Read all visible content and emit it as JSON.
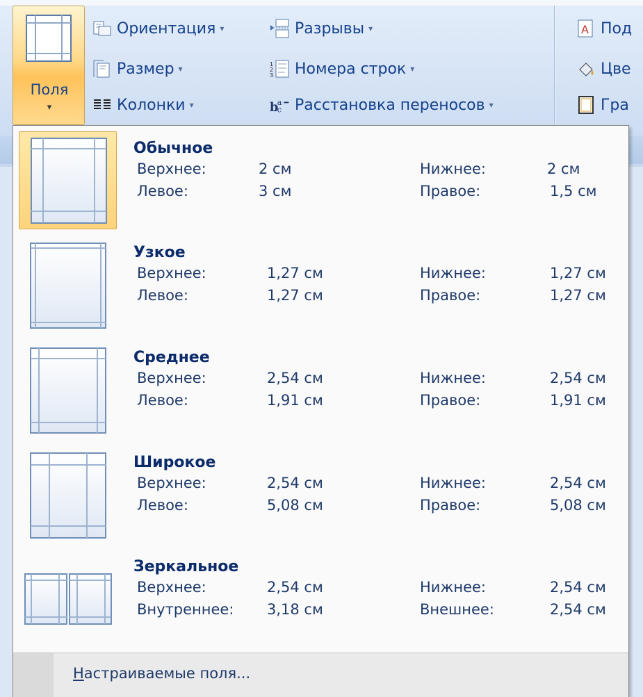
{
  "ribbon": {
    "fields_button": {
      "label": "Поля",
      "arrow": "▾"
    },
    "items": [
      {
        "label": "Ориентация",
        "arrow": "▾",
        "icon": "orientation-icon"
      },
      {
        "label": "Размер",
        "arrow": "▾",
        "icon": "size-icon"
      },
      {
        "label": "Колонки",
        "arrow": "▾",
        "icon": "columns-icon"
      },
      {
        "label": "Разрывы",
        "arrow": "▾",
        "icon": "breaks-icon"
      },
      {
        "label": "Номера строк",
        "arrow": "▾",
        "icon": "line-numbers-icon"
      },
      {
        "label": "Расстановка переносов",
        "arrow": "▾",
        "icon": "hyphenation-icon"
      },
      {
        "label": "Под",
        "icon": "watermark-icon"
      },
      {
        "label": "Цве",
        "icon": "page-color-icon"
      },
      {
        "label": "Гра",
        "icon": "page-borders-icon"
      }
    ]
  },
  "menu": {
    "options": [
      {
        "name": "Обычное",
        "selected": true,
        "l1": "Верхнее:",
        "v1": "2 см",
        "l2": "Нижнее:",
        "v2": "2 см",
        "l3": "Левое:",
        "v3": "3 см",
        "l4": "Правое:",
        "v4": "1,5 см"
      },
      {
        "name": "Узкое",
        "selected": false,
        "l1": "Верхнее:",
        "v1": "1,27 см",
        "l2": "Нижнее:",
        "v2": "1,27 см",
        "l3": "Левое:",
        "v3": "1,27 см",
        "l4": "Правое:",
        "v4": "1,27 см"
      },
      {
        "name": "Среднее",
        "selected": false,
        "l1": "Верхнее:",
        "v1": "2,54 см",
        "l2": "Нижнее:",
        "v2": "2,54 см",
        "l3": "Левое:",
        "v3": "1,91 см",
        "l4": "Правое:",
        "v4": "1,91 см"
      },
      {
        "name": "Широкое",
        "selected": false,
        "l1": "Верхнее:",
        "v1": "2,54 см",
        "l2": "Нижнее:",
        "v2": "2,54 см",
        "l3": "Левое:",
        "v3": "5,08 см",
        "l4": "Правое:",
        "v4": "5,08 см"
      },
      {
        "name": "Зеркальное",
        "selected": false,
        "l1": "Верхнее:",
        "v1": "2,54 см",
        "l2": "Нижнее:",
        "v2": "2,54 см",
        "l3": "Внутреннее:",
        "v3": "3,18 см",
        "l4": "Внешнее:",
        "v4": "2,54 см"
      }
    ],
    "custom": {
      "underlined": "Н",
      "rest": "астраиваемые поля..."
    }
  },
  "colors": {
    "selected_bg": "#ffd37a",
    "text": "#15428b",
    "menu_bg": "#fafafa"
  }
}
